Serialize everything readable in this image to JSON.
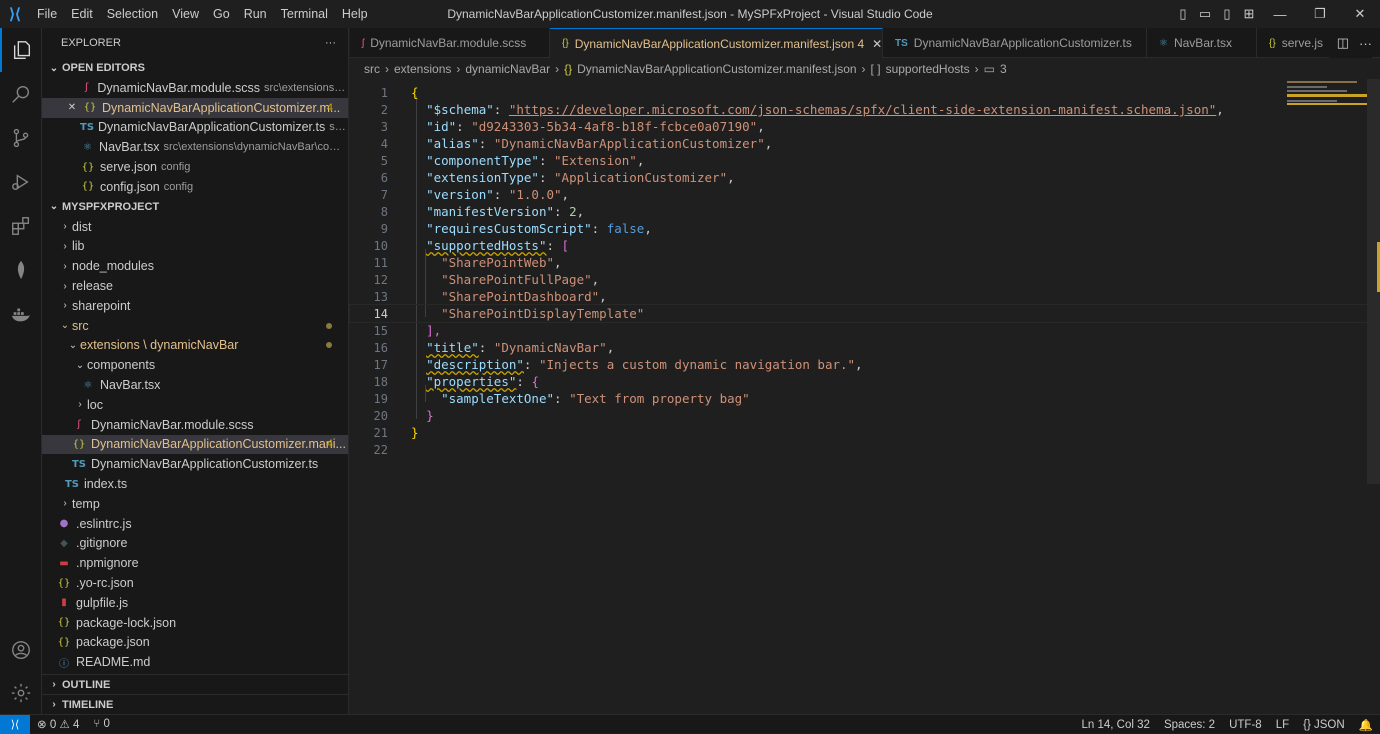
{
  "window": {
    "title": "DynamicNavBarApplicationCustomizer.manifest.json - MySPFxProject - Visual Studio Code"
  },
  "menu": [
    "File",
    "Edit",
    "Selection",
    "View",
    "Go",
    "Run",
    "Terminal",
    "Help"
  ],
  "explorer": {
    "header": "EXPLORER",
    "more": "···",
    "open_editors": {
      "title": "OPEN EDITORS",
      "items": [
        {
          "icon": "scss-icon",
          "name": "DynamicNavBar.module.scss",
          "desc": "src\\extensions\\dyn..."
        },
        {
          "icon": "json-icon",
          "name": "DynamicNavBarApplicationCustomizer.m...",
          "badge": "4"
        },
        {
          "icon": "ts-icon",
          "name": "DynamicNavBarApplicationCustomizer.ts",
          "desc": "src\\e..."
        },
        {
          "icon": "react-icon",
          "name": "NavBar.tsx",
          "desc": "src\\extensions\\dynamicNavBar\\compo..."
        },
        {
          "icon": "json-icon",
          "name": "serve.json",
          "desc": "config"
        },
        {
          "icon": "json-icon",
          "name": "config.json",
          "desc": "config"
        }
      ]
    },
    "project": {
      "title": "MYSPFXPROJECT",
      "items": [
        {
          "label": "dist"
        },
        {
          "label": "lib"
        },
        {
          "label": "node_modules"
        },
        {
          "label": "release"
        },
        {
          "label": "sharepoint"
        },
        {
          "label": "src"
        },
        {
          "label": "extensions \\ dynamicNavBar"
        },
        {
          "label": "components"
        },
        {
          "label": "NavBar.tsx"
        },
        {
          "label": "loc"
        },
        {
          "label": "DynamicNavBar.module.scss"
        },
        {
          "label": "DynamicNavBarApplicationCustomizer.mani...",
          "badge": "4"
        },
        {
          "label": "DynamicNavBarApplicationCustomizer.ts"
        },
        {
          "label": "index.ts"
        },
        {
          "label": "temp"
        },
        {
          "label": ".eslintrc.js"
        },
        {
          "label": ".gitignore"
        },
        {
          "label": ".npmignore"
        },
        {
          "label": ".yo-rc.json"
        },
        {
          "label": "gulpfile.js"
        },
        {
          "label": "package-lock.json"
        },
        {
          "label": "package.json"
        },
        {
          "label": "README.md"
        }
      ]
    },
    "outline": "OUTLINE",
    "timeline": "TIMELINE"
  },
  "tabs": [
    {
      "label": "DynamicNavBar.module.scss"
    },
    {
      "label": "DynamicNavBarApplicationCustomizer.manifest.json 4"
    },
    {
      "label": "DynamicNavBarApplicationCustomizer.ts"
    },
    {
      "label": "NavBar.tsx"
    },
    {
      "label": "serve.js"
    }
  ],
  "breadcrumbs": {
    "parts": [
      "src",
      "extensions",
      "dynamicNavBar",
      "DynamicNavBarApplicationCustomizer.manifest.json",
      "supportedHosts",
      "3"
    ]
  },
  "editor": {
    "current_line": 14,
    "lines": [
      {
        "n": "1",
        "t": "{"
      },
      {
        "n": "2",
        "k": "\"$schema\"",
        "v": "\"https://developer.microsoft.com/json-schemas/spfx/client-side-extension-manifest.schema.json\""
      },
      {
        "n": "3",
        "k": "\"id\"",
        "v": "\"d9243303-5b34-4af8-b18f-fcbce0a07190\""
      },
      {
        "n": "4",
        "k": "\"alias\"",
        "v": "\"DynamicNavBarApplicationCustomizer\""
      },
      {
        "n": "5",
        "k": "\"componentType\"",
        "v": "\"Extension\""
      },
      {
        "n": "6",
        "k": "\"extensionType\"",
        "v": "\"ApplicationCustomizer\""
      },
      {
        "n": "7",
        "k": "\"version\"",
        "v": "\"1.0.0\""
      },
      {
        "n": "8",
        "k": "\"manifestVersion\"",
        "v": "2"
      },
      {
        "n": "9",
        "k": "\"requiresCustomScript\"",
        "v": "false"
      },
      {
        "n": "10",
        "k": "\"supportedHosts\""
      },
      {
        "n": "11",
        "v": "\"SharePointWeb\""
      },
      {
        "n": "12",
        "v": "\"SharePointFullPage\""
      },
      {
        "n": "13",
        "v": "\"SharePointDashboard\""
      },
      {
        "n": "14",
        "v": "\"SharePointDisplayTemplate\""
      },
      {
        "n": "15",
        "t": "],"
      },
      {
        "n": "16",
        "k": "\"title\"",
        "v": "\"DynamicNavBar\""
      },
      {
        "n": "17",
        "k": "\"description\"",
        "v": "\"Injects a custom dynamic navigation bar.\""
      },
      {
        "n": "18",
        "k": "\"properties\""
      },
      {
        "n": "19",
        "k": "\"sampleTextOne\"",
        "v": "\"Text from property bag\""
      },
      {
        "n": "20",
        "t": "}"
      },
      {
        "n": "21",
        "t": "}"
      },
      {
        "n": "22",
        "t": ""
      }
    ]
  },
  "status": {
    "errors": "0",
    "warnings": "4",
    "ports": "0",
    "position": "Ln 14, Col 32",
    "spaces": "Spaces: 2",
    "encoding": "UTF-8",
    "eol": "LF",
    "language": "JSON"
  }
}
